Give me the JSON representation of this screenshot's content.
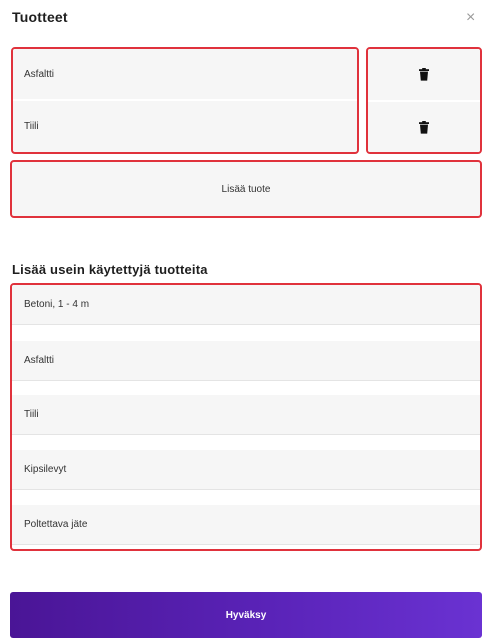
{
  "dialog": {
    "title": "Tuotteet",
    "close_symbol": "×"
  },
  "products": {
    "items": [
      {
        "label": "Asfaltti"
      },
      {
        "label": "Tiili"
      }
    ],
    "delete_icon": "trash-icon",
    "add_label": "Lisää tuote"
  },
  "frequent": {
    "heading": "Lisää usein käytettyjä tuotteita",
    "items": [
      {
        "label": "Betoni, 1 - 4 m"
      },
      {
        "label": "Asfaltti"
      },
      {
        "label": "Tiili"
      },
      {
        "label": "Kipsilevyt"
      },
      {
        "label": "Poltettava jäte"
      }
    ]
  },
  "footer": {
    "accept_label": "Hyväksy"
  },
  "colors": {
    "highlight_border": "#e0323c",
    "accept_gradient_start": "#4a1596",
    "accept_gradient_end": "#6a32d2",
    "row_background": "#f6f6f6"
  }
}
